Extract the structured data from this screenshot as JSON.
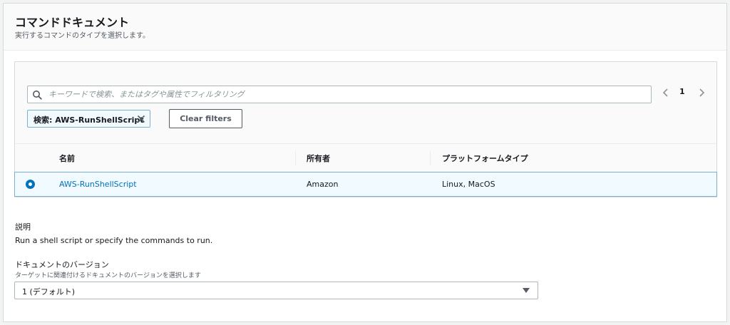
{
  "header": {
    "title": "コマンドドキュメント",
    "subtitle": "実行するコマンドのタイプを選択します。"
  },
  "search": {
    "placeholder": "キーワードで検索、またはタグや属性でフィルタリング",
    "value": ""
  },
  "pagination": {
    "current_page": "1"
  },
  "filter_token": {
    "label": "検索: AWS-RunShellScript"
  },
  "clear_filters_label": "Clear filters",
  "table": {
    "columns": [
      "名前",
      "所有者",
      "プラットフォームタイプ"
    ],
    "rows": [
      {
        "selected": true,
        "name": "AWS-RunShellScript",
        "owner": "Amazon",
        "platform": "Linux, MacOS"
      }
    ]
  },
  "description": {
    "label": "説明",
    "text": "Run a shell script or specify the commands to run."
  },
  "document_version": {
    "label": "ドキュメントのバージョン",
    "hint": "ターゲットに関連付けるドキュメントのバージョンを選択します",
    "selected": "1 (デフォルト)"
  },
  "colors": {
    "accent": "#0073bb",
    "selected_row_bg": "#f1faff",
    "selected_row_border": "#7faed4"
  }
}
